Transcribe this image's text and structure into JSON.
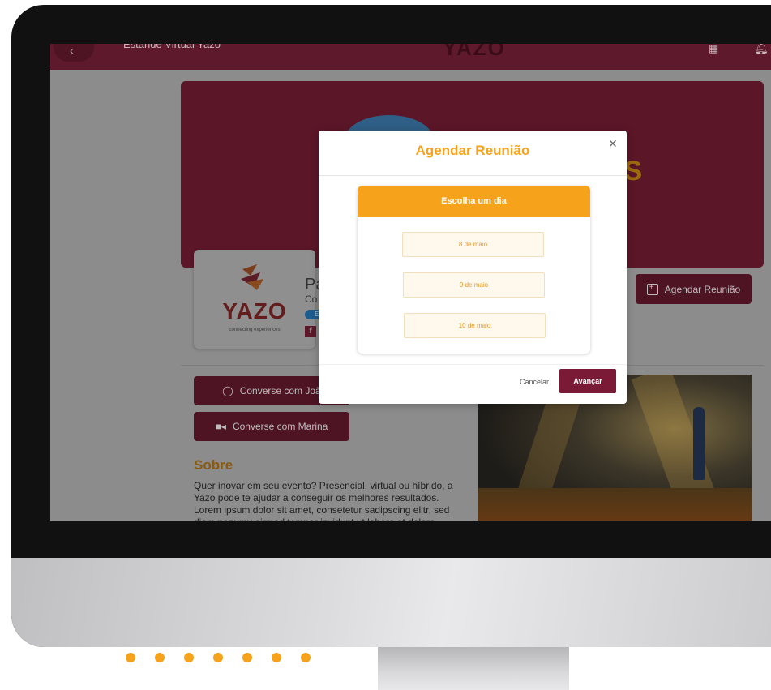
{
  "colors": {
    "brand": "#7a1a36",
    "accent": "#f7a21b",
    "dots": "#f7a21b"
  },
  "appbar": {
    "title": "Estande Virtual Yazo",
    "brand": "YAZO",
    "back_icon": "back-arrow-icon",
    "icons": [
      "grid-icon",
      "bell-icon"
    ]
  },
  "banner": {
    "partial_text": "OS"
  },
  "company": {
    "logo_word": "YAZO",
    "logo_tagline": "connecting experiences",
    "name_partial": "Pá",
    "sub_partial": "Co",
    "pill_partial": "E",
    "social_icon": "facebook-icon"
  },
  "actions": {
    "agendar_label": "Agendar Reunião",
    "chat1_label": "Converse com Joã",
    "chat2_label": "Converse com Marina"
  },
  "about": {
    "title": "Sobre",
    "text": "Quer inovar em seu evento? Presencial, virtual ou híbrido, a Yazo pode te ajudar a conseguir os melhores resultados. Lorem ipsum dolor sit amet, consetetur sadipscing elitr, sed diam nonumy eirmod tempor invidunt ut labore et dolore magna"
  },
  "modal": {
    "title": "Agendar Reunião",
    "close_icon": "close-icon",
    "card_title": "Escolha um dia",
    "days": [
      "8 de maio",
      "9 de maio",
      "10 de maio"
    ],
    "cancel_label": "Cancelar",
    "next_label": "Avançar"
  }
}
